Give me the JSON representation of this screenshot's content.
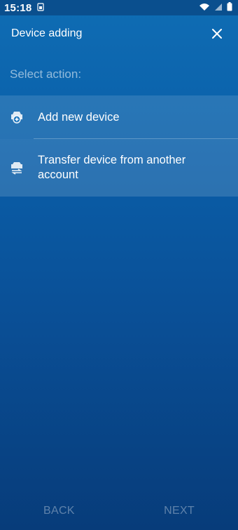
{
  "status_bar": {
    "time": "15:18",
    "icons": [
      "sim-icon",
      "wifi-icon",
      "signal-icon",
      "battery-icon"
    ]
  },
  "app_bar": {
    "title": "Device adding",
    "close_icon": "close-icon"
  },
  "section_label": "Select action:",
  "actions": [
    {
      "label": "Add new device",
      "icon": "car-add-icon"
    },
    {
      "label": "Transfer device from another account",
      "icon": "car-transfer-icon"
    }
  ],
  "footer": {
    "back_label": "BACK",
    "next_label": "NEXT"
  },
  "colors": {
    "background_top": "#0f6db4",
    "background_bottom": "#073c7a",
    "status_bar": "#0a4f8e",
    "text": "#ffffff"
  }
}
